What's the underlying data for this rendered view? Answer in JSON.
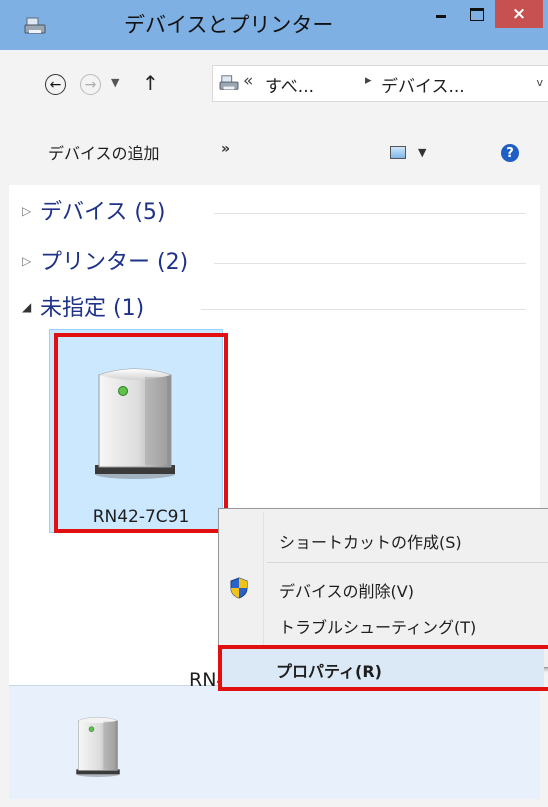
{
  "window": {
    "title": "デバイスとプリンター",
    "close_glyph": "×"
  },
  "nav": {
    "back_glyph": "←",
    "forward_glyph": "→",
    "recent_glyph": "▼",
    "up_glyph": "↑"
  },
  "address": {
    "overflow": "«",
    "crumb1": "すべ...",
    "separator": "▸",
    "crumb2": "デバイス...",
    "dropdown_glyph": "v"
  },
  "toolbar": {
    "add_device": "デバイスの追加",
    "more": "»",
    "view_dropdown_glyph": "▼",
    "help_glyph": "?"
  },
  "groups": [
    {
      "title": "デバイス (5)",
      "expanded": false,
      "arrow": "▷"
    },
    {
      "title": "プリンター (2)",
      "expanded": false,
      "arrow": "▷"
    },
    {
      "title": "未指定 (1)",
      "expanded": true,
      "arrow": "◢"
    }
  ],
  "device": {
    "name": "RN42-7C91",
    "icon": "generic-device-tower-icon"
  },
  "context_menu": {
    "items": [
      {
        "label": "ショートカットの作成(S)"
      },
      {
        "label": "デバイスの削除(V)",
        "icon": "uac-shield-icon"
      },
      {
        "label": "トラブルシューティング(T)"
      },
      {
        "label": "プロパティ(R)",
        "bold": true,
        "highlighted": true
      }
    ]
  },
  "details": {
    "name": "RN42-7C91"
  },
  "colors": {
    "titlebar": "#7fb0e3",
    "close_button": "#c75050",
    "selection": "#cce8ff",
    "highlight_outline": "#e10f0f",
    "group_title": "#1e3287"
  }
}
